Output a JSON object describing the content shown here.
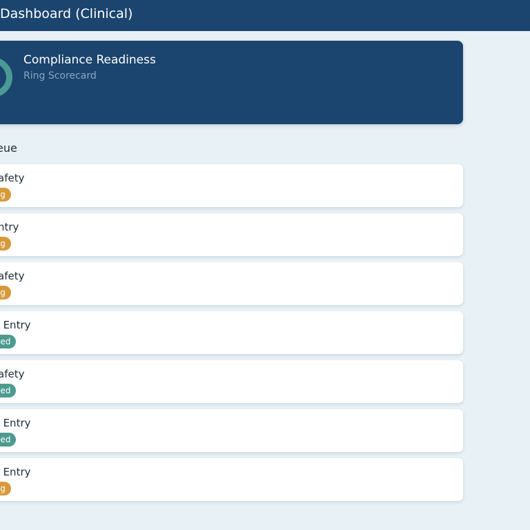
{
  "header": {
    "title": "Dashboard (Clinical)"
  },
  "scorecard": {
    "title": "Compliance Readiness",
    "subtitle": "Ring Scorecard"
  },
  "queue": {
    "title": "eue",
    "items": [
      {
        "title": "ab Safety",
        "status": "ling",
        "status_kind": "pending"
      },
      {
        "title": "ab Entry",
        "status": "ling",
        "status_kind": "pending"
      },
      {
        "title": "ab Safety",
        "status": "ling",
        "status_kind": "pending"
      },
      {
        "title": "Data Entry",
        "status": "oved",
        "status_kind": "approved"
      },
      {
        "title": "ab Safety",
        "status": "oved",
        "status_kind": "approved"
      },
      {
        "title": "Data Entry",
        "status": "oved",
        "status_kind": "approved"
      },
      {
        "title": "Data Entry",
        "status": "ling",
        "status_kind": "pending"
      }
    ]
  },
  "colors": {
    "header_bg": "#1b456e",
    "page_bg": "#e8f1f5",
    "pending": "#d69a3b",
    "approved": "#4d9a8f",
    "ring": "#4a9b94"
  }
}
